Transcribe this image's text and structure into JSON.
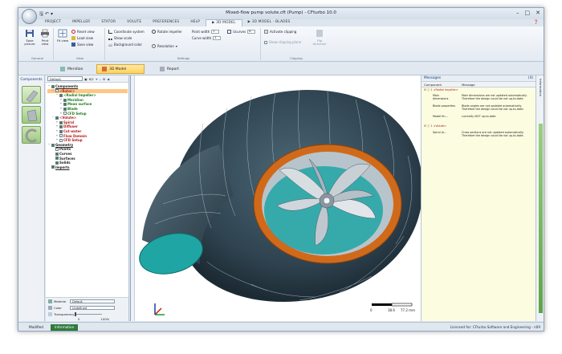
{
  "window": {
    "title": "Mixed-flow pump volute.cft (Pump) - CFturbo 10.0"
  },
  "ribbon_tabs": [
    "PROJECT",
    "IMPELLER",
    "STATOR",
    "VOLUTE",
    "PREFERENCES",
    "HELP",
    "▶ 3D MODEL",
    "▶ 3D MODEL - BLADES"
  ],
  "ribbon": {
    "general": {
      "label": "General",
      "save_picture": "Save picture",
      "print_view": "Print view"
    },
    "view": {
      "label": "View",
      "fit_view": "Fit view",
      "reset_view": "Reset view",
      "load_view": "Load view",
      "save_view": "Save view"
    },
    "settings": {
      "label": "Settings",
      "coordinate_system": "Coordinate system",
      "show_scale": "Show scale",
      "background_color": "Background color",
      "rotate_impeller": "Rotate impeller",
      "resolution": "Resolution",
      "point_width_label": "Point width",
      "point_width_value": "3",
      "curve_width_label": "Curve width",
      "curve_width_value": "1",
      "uv_curves_label": "Ucurves",
      "uv_curves_value": "8"
    },
    "clipping": {
      "label": "Clipping",
      "activate_clipping": "Activate clipping",
      "show_clipping_plane": "Show clipping plane",
      "flip_direction": "Flip direction"
    }
  },
  "view_tabs": {
    "meridian": "Meridian",
    "model_3d": "3D Model",
    "report": "Report"
  },
  "components": {
    "header": "Components"
  },
  "tree": {
    "preset": "Default",
    "preset_suffix": "8/2",
    "nodes": [
      {
        "label": "Components",
        "indent": 0,
        "cls": "t-dark",
        "exp": "−",
        "checked": true,
        "underline": true
      },
      {
        "label": "<Rotor>",
        "indent": 1,
        "cls": "t-red",
        "exp": "−",
        "checked": false,
        "hl": true
      },
      {
        "label": "<Radial Impeller>",
        "indent": 2,
        "cls": "t-green",
        "exp": "−",
        "checked": true
      },
      {
        "label": "Meridian",
        "indent": 3,
        "cls": "t-green",
        "exp": "+",
        "checked": true
      },
      {
        "label": "Mean surface",
        "indent": 3,
        "cls": "t-green",
        "exp": "+",
        "checked": true
      },
      {
        "label": "Blade",
        "indent": 3,
        "cls": "t-green",
        "exp": "+",
        "checked": true
      },
      {
        "label": "CFD Setup",
        "indent": 3,
        "cls": "t-green",
        "exp": "+",
        "checked": false
      },
      {
        "label": "<Volute>",
        "indent": 1,
        "cls": "t-red",
        "exp": "−",
        "checked": true
      },
      {
        "label": "Spiral",
        "indent": 2,
        "cls": "t-red",
        "exp": "+",
        "checked": true
      },
      {
        "label": "Diffuser",
        "indent": 2,
        "cls": "t-red",
        "exp": "+",
        "checked": true
      },
      {
        "label": "Cut-water",
        "indent": 2,
        "cls": "t-red",
        "exp": "+",
        "checked": true
      },
      {
        "label": "Flow Domain",
        "indent": 2,
        "cls": "t-red",
        "exp": "+",
        "checked": false
      },
      {
        "label": "CFD Setup",
        "indent": 2,
        "cls": "t-red",
        "exp": "+",
        "checked": false
      },
      {
        "label": "Geometry",
        "indent": 0,
        "cls": "t-dark",
        "exp": "−",
        "checked": true,
        "underline": true
      },
      {
        "label": "Points",
        "indent": 1,
        "cls": "t-dark",
        "exp": "",
        "checked": false
      },
      {
        "label": "Curves",
        "indent": 1,
        "cls": "t-dark",
        "exp": "",
        "checked": true
      },
      {
        "label": "Surfaces",
        "indent": 1,
        "cls": "t-dark",
        "exp": "",
        "checked": true
      },
      {
        "label": "Solids",
        "indent": 1,
        "cls": "t-dark",
        "exp": "",
        "checked": true
      },
      {
        "label": "Imports",
        "indent": 0,
        "cls": "t-dark",
        "exp": "",
        "checked": true,
        "underline": true
      }
    ]
  },
  "props": {
    "material_label": "Material",
    "material_value": "Default",
    "color_label": "Color",
    "color_value": "Undefined",
    "transparency_label": "Transparency",
    "transparency_min": "0",
    "transparency_max": "100%"
  },
  "scale": {
    "t0": "0",
    "t1": "38.6",
    "t2": "77.2 mm"
  },
  "messages": {
    "header": "Messages",
    "count": "(4)",
    "col_component": "Component",
    "col_message": "Message",
    "group_impeller": "1 <Radial Impeller>",
    "group_volute": "1 <Volute>",
    "rows": [
      {
        "component": "Main dimensions",
        "message": "Main dimensions are not updated automatically. Therefore the design could be not up-to-date."
      },
      {
        "component": "Blade properties",
        "message": "Blade angles are not updated automatically. Therefore the design could be not up-to-date."
      },
      {
        "component": "Model fin...",
        "message": "currently NOT up-to-date"
      },
      {
        "component": "Spiral (e...",
        "message": "Cross sections are not updated automatically. Therefore the design could be not up-to-date."
      }
    ]
  },
  "right_side": {
    "label": "Information"
  },
  "status": {
    "tab_modified": "Modified",
    "tab_information": "Information",
    "license": "Licensed for: CFturbo Software and Engineering - n09"
  },
  "colors": {
    "volute_body": "#2f4350",
    "volute_inner": "#1fa6a4",
    "ring": "#d06a1a",
    "selected_tab": "#ffd25a",
    "status_green": "#2e7a3b"
  }
}
